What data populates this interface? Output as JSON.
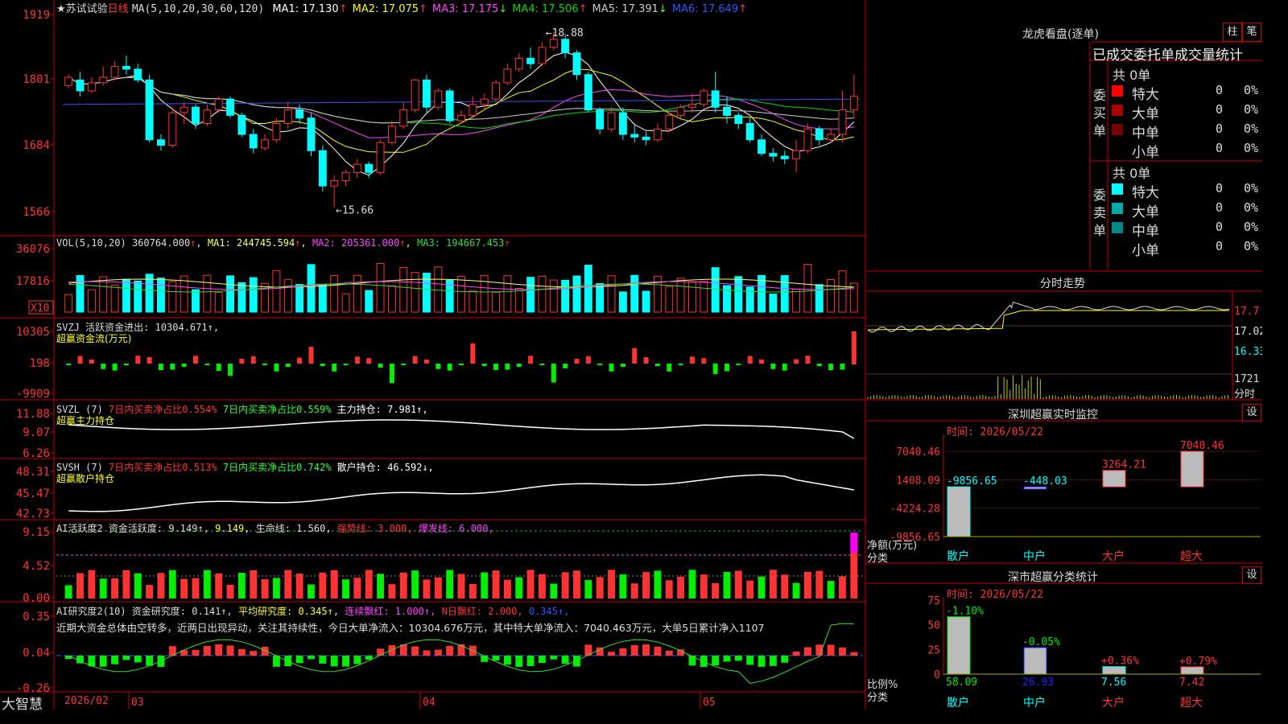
{
  "footer": {
    "logo": "大智慧",
    "date_label": "2026/02"
  },
  "main_chart": {
    "title": "★苏试试验",
    "period": "日线",
    "ma_header": "MA(5,10,20,30,60,120)",
    "ma": [
      {
        "name": "MA1:",
        "val": "17.130",
        "arrow": "↑",
        "color": "#ffffff"
      },
      {
        "name": "MA2:",
        "val": "17.075",
        "arrow": "↑",
        "color": "#ffff00"
      },
      {
        "name": "MA3:",
        "val": "17.175",
        "arrow": "↓",
        "color": "#ff44ff"
      },
      {
        "name": "MA4:",
        "val": "17.506",
        "arrow": "↑",
        "color": "#00dd00"
      },
      {
        "name": "MA5:",
        "val": "17.391",
        "arrow": "↓",
        "color": "#cccccc"
      },
      {
        "name": "MA6:",
        "val": "17.649",
        "arrow": "↑",
        "color": "#3355ff"
      }
    ],
    "y_ticks": [
      "1919",
      "1801",
      "1684",
      "1566"
    ],
    "high_label": "18.88",
    "low_label": "15.66",
    "x_labels": [
      "03",
      "04",
      "05"
    ]
  },
  "vol_panel": {
    "header": "VOL(5,10,20)",
    "val": "360764.000",
    "ma1": "MA1: 244745.594",
    "ma2": "MA2: 205361.000",
    "ma3": "MA3: 194667.453",
    "y_ticks": [
      "36076",
      "17816"
    ],
    "unit": "X10"
  },
  "svzj_panel": {
    "header": "SVZJ  活跃资金进出: 10304.671↑,",
    "sub": "超赢资金流(万元)",
    "y_ticks": [
      "10305",
      "198",
      "-9909"
    ]
  },
  "svzl_panel": {
    "name": "SVZL (7)",
    "a": "7日内买卖净占比0.554%",
    "b": "7日内买卖净占比0.559%",
    "c": "主力持仓: 7.981↑,",
    "sub": "超赢主力持仓",
    "y_ticks": [
      "11.88",
      "9.07",
      "6.26"
    ]
  },
  "svsh_panel": {
    "name": "SVSH (7)",
    "a": "7日内买卖净占比0.513%",
    "b": "7日内买卖净占比0.742%",
    "c": "散户持仓: 46.592↓,",
    "sub": "超赢散户持仓",
    "y_ticks": [
      "48.31",
      "45.47",
      "42.73"
    ]
  },
  "ai2_panel": {
    "a": "AI活跃度2 资金活跃度: 9.149↑,",
    "b": "9.149,",
    "c": "生命线: 1.560,",
    "d": "强势线: 3.000,",
    "e": "爆发线: 6.000,",
    "y_ticks": [
      "9.15",
      "4.52",
      "0.00"
    ]
  },
  "ai_research_panel": {
    "a": "AI研究度2(10) 资金研究度: 0.141↑,",
    "b": "平均研究度: 0.345↑,",
    "c": "连续飘红: 1.000↑,",
    "d": "N日飘红: 2.000,",
    "e": "0.345↑,",
    "note": "近期大资金总体由空转多，近两日出现异动，关注其持续性，今日大单净流入：10304.676万元，其中特大单净流入：7040.463万元，大单5日累计净入1107",
    "y_ticks": [
      "0.35",
      "0.04",
      "-0.26"
    ]
  },
  "dragon_panel": {
    "title": "龙虎看盘(逐单)",
    "btn1": "柱",
    "btn2": "笔",
    "tabs": "已成交委托单成交量统计",
    "buy_label": "委买单",
    "sell_label": "委卖单",
    "buy_total": "共 0单",
    "sell_total": "共 0单",
    "buy_rows": [
      {
        "label": "特大",
        "count": "0",
        "pct": "0%",
        "color": "#ff0000"
      },
      {
        "label": "大单",
        "count": "0",
        "pct": "0%",
        "color": "#aa0000"
      },
      {
        "label": "中单",
        "count": "0",
        "pct": "0%",
        "color": "#770000"
      },
      {
        "label": "小单",
        "count": "0",
        "pct": "0%",
        "color": "#000000"
      }
    ],
    "sell_rows": [
      {
        "label": "特大",
        "count": "0",
        "pct": "0%",
        "color": "#00ffff"
      },
      {
        "label": "大单",
        "count": "0",
        "pct": "0%",
        "color": "#00aaaa"
      },
      {
        "label": "中单",
        "count": "0",
        "pct": "0%",
        "color": "#008888"
      },
      {
        "label": "小单",
        "count": "0",
        "pct": "0%",
        "color": "#000000"
      }
    ]
  },
  "intraday_panel": {
    "title": "分时走势",
    "y_ticks": [
      "17.7",
      "17.02",
      "16.33",
      "1721"
    ],
    "unit": "分时"
  },
  "sz_monitor": {
    "title": "深圳超赢实时监控",
    "btn": "设",
    "time": "时间: 2026/05/22",
    "y_ticks": [
      "7040.46",
      "1408.09",
      "-4224.28",
      "-9856.65"
    ],
    "ylabel": "净额(万元)",
    "xlabel": "分类",
    "categories": [
      "散户",
      "中户",
      "大户",
      "超大"
    ],
    "values": [
      -9856.65,
      -448.03,
      3264.21,
      7040.46
    ],
    "value_labels": [
      "-9856.65",
      "-448.03",
      "3264.21",
      "7040.46"
    ]
  },
  "sz_class": {
    "title": "深市超赢分类统计",
    "btn": "设",
    "time": "时间: 2026/05/22",
    "y_ticks": [
      "75",
      "50",
      "25",
      "0"
    ],
    "ylabel": "比例%",
    "xlabel": "分类",
    "categories": [
      "散户",
      "中户",
      "大户",
      "超大"
    ],
    "values": [
      58.09,
      26.93,
      7.56,
      7.42
    ],
    "pct_labels": [
      "-1.10%",
      "-0.05%",
      "+0.36%",
      "+0.79%"
    ],
    "value_labels": [
      "58.09",
      "26.93",
      "7.56",
      "7.42"
    ]
  },
  "chart_data": [
    {
      "type": "candlestick",
      "title": "★苏试试验",
      "ylim": [
        15.66,
        18.88
      ],
      "high": 18.88,
      "low": 15.66,
      "x_labels": [
        "2026/02",
        "03",
        "04",
        "05"
      ],
      "ohlc": [
        [
          17.9,
          18.1,
          17.85,
          18.05
        ],
        [
          18.0,
          18.15,
          17.7,
          17.8
        ],
        [
          17.8,
          18.05,
          17.75,
          17.95
        ],
        [
          17.95,
          18.25,
          17.9,
          18.05
        ],
        [
          18.05,
          18.35,
          18.0,
          18.25
        ],
        [
          18.25,
          18.45,
          18.1,
          18.2
        ],
        [
          18.2,
          18.3,
          17.95,
          18.0
        ],
        [
          18.0,
          18.1,
          16.85,
          16.9
        ],
        [
          16.9,
          17.0,
          16.7,
          16.8
        ],
        [
          16.8,
          17.5,
          16.75,
          17.4
        ],
        [
          17.4,
          17.6,
          17.2,
          17.5
        ],
        [
          17.5,
          17.55,
          17.1,
          17.2
        ],
        [
          17.2,
          17.55,
          17.15,
          17.45
        ],
        [
          17.45,
          17.7,
          17.4,
          17.65
        ],
        [
          17.65,
          17.7,
          17.3,
          17.35
        ],
        [
          17.35,
          17.4,
          16.95,
          17.0
        ],
        [
          17.0,
          17.1,
          16.65,
          16.75
        ],
        [
          16.75,
          17.0,
          16.7,
          16.9
        ],
        [
          16.9,
          17.3,
          16.85,
          17.2
        ],
        [
          17.2,
          17.6,
          17.1,
          17.45
        ],
        [
          17.45,
          17.55,
          17.2,
          17.3
        ],
        [
          17.3,
          17.4,
          16.6,
          16.7
        ],
        [
          16.7,
          16.8,
          15.95,
          16.05
        ],
        [
          16.05,
          16.25,
          15.66,
          16.15
        ],
        [
          16.15,
          16.35,
          16.05,
          16.3
        ],
        [
          16.3,
          16.55,
          16.2,
          16.45
        ],
        [
          16.45,
          16.5,
          16.2,
          16.3
        ],
        [
          16.3,
          16.9,
          16.25,
          16.85
        ],
        [
          16.85,
          17.25,
          16.8,
          17.15
        ],
        [
          17.15,
          17.6,
          17.1,
          17.45
        ],
        [
          17.45,
          17.8,
          17.4,
          18.0
        ],
        [
          18.0,
          18.1,
          17.4,
          17.5
        ],
        [
          17.5,
          17.85,
          17.45,
          17.8
        ],
        [
          17.8,
          17.85,
          17.2,
          17.25
        ],
        [
          17.25,
          17.45,
          17.2,
          17.35
        ],
        [
          17.35,
          17.7,
          17.3,
          17.55
        ],
        [
          17.55,
          17.75,
          17.45,
          17.65
        ],
        [
          17.65,
          18.0,
          17.6,
          17.95
        ],
        [
          17.95,
          18.3,
          17.9,
          18.2
        ],
        [
          18.2,
          18.5,
          18.15,
          18.4
        ],
        [
          18.4,
          18.6,
          18.2,
          18.3
        ],
        [
          18.3,
          18.7,
          18.25,
          18.6
        ],
        [
          18.6,
          18.88,
          18.55,
          18.75
        ],
        [
          18.75,
          18.85,
          18.4,
          18.5
        ],
        [
          18.5,
          18.55,
          18.0,
          18.1
        ],
        [
          18.1,
          18.15,
          17.4,
          17.45
        ],
        [
          17.45,
          17.5,
          17.0,
          17.1
        ],
        [
          17.1,
          17.5,
          17.05,
          17.4
        ],
        [
          17.4,
          17.5,
          16.9,
          17.0
        ],
        [
          17.0,
          17.2,
          16.85,
          16.95
        ],
        [
          16.95,
          17.05,
          16.8,
          16.9
        ],
        [
          16.9,
          17.2,
          16.85,
          17.1
        ],
        [
          17.1,
          17.4,
          17.05,
          17.35
        ],
        [
          17.35,
          17.55,
          17.3,
          17.5
        ],
        [
          17.5,
          17.75,
          17.4,
          17.55
        ],
        [
          17.55,
          17.85,
          17.5,
          17.8
        ],
        [
          17.8,
          18.15,
          17.4,
          17.5
        ],
        [
          17.5,
          17.7,
          17.2,
          17.35
        ],
        [
          17.35,
          17.4,
          17.1,
          17.2
        ],
        [
          17.2,
          17.3,
          16.85,
          16.9
        ],
        [
          16.9,
          17.0,
          16.6,
          16.65
        ],
        [
          16.65,
          16.75,
          16.5,
          16.6
        ],
        [
          16.6,
          16.7,
          16.45,
          16.55
        ],
        [
          16.55,
          16.9,
          16.3,
          16.7
        ],
        [
          16.7,
          17.2,
          16.65,
          17.1
        ],
        [
          17.1,
          17.15,
          16.8,
          16.9
        ],
        [
          16.9,
          17.1,
          16.85,
          17.0
        ],
        [
          17.0,
          17.8,
          16.85,
          17.45
        ],
        [
          17.45,
          18.1,
          17.3,
          17.7
        ]
      ]
    },
    {
      "type": "bar",
      "title": "深圳超赢实时监控",
      "categories": [
        "散户",
        "中户",
        "大户",
        "超大"
      ],
      "values": [
        -9856.65,
        -448.03,
        3264.21,
        7040.46
      ],
      "ylabel": "净额(万元)",
      "ylim": [
        -9856.65,
        7040.46
      ]
    },
    {
      "type": "bar",
      "title": "深市超赢分类统计",
      "categories": [
        "散户",
        "中户",
        "大户",
        "超大"
      ],
      "values": [
        58.09,
        26.93,
        7.56,
        7.42
      ],
      "ylabel": "比例%",
      "ylim": [
        0,
        75
      ]
    }
  ]
}
